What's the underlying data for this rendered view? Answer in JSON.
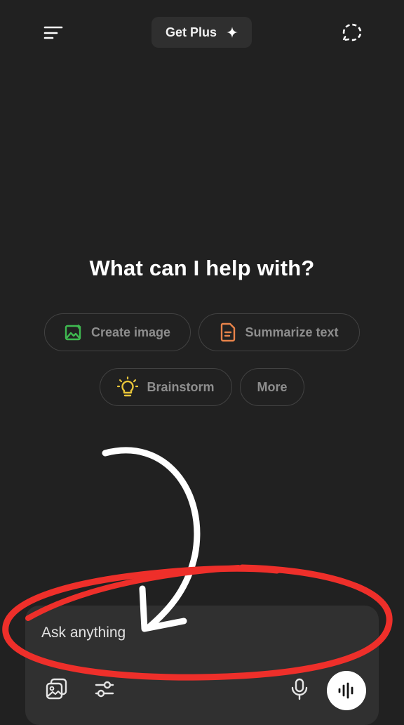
{
  "header": {
    "menu_icon": "menu-icon",
    "upgrade_label": "Get Plus",
    "upgrade_icon": "sparkle-icon",
    "new_chat_icon": "new-chat-icon"
  },
  "main": {
    "headline": "What can I help with?",
    "suggestions": [
      {
        "label": "Create image",
        "icon": "image-icon",
        "icon_color": "#3fb950"
      },
      {
        "label": "Summarize text",
        "icon": "document-icon",
        "icon_color": "#e8834a"
      },
      {
        "label": "Brainstorm",
        "icon": "lightbulb-icon",
        "icon_color": "#e8c53a"
      },
      {
        "label": "More",
        "icon": null,
        "icon_color": null
      }
    ]
  },
  "composer": {
    "placeholder": "Ask anything",
    "attach_icon": "photos-icon",
    "tools_icon": "sliders-icon",
    "mic_icon": "microphone-icon",
    "voice_icon": "voice-waveform-icon"
  },
  "overlay": {
    "arrow_color": "#ffffff",
    "circle_color": "#ee2f2a"
  },
  "colors": {
    "background": "#212121",
    "chip_border": "#424242",
    "composer_bg": "#303030"
  }
}
